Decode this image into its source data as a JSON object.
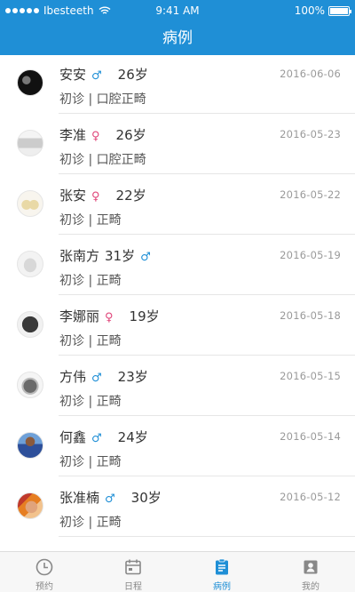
{
  "status": {
    "carrier": "Ibesteeth",
    "time": "9:41 AM",
    "battery": "100%"
  },
  "header": {
    "title": "病例"
  },
  "colors": {
    "accent": "#1f8fd6",
    "female": "#e0467a"
  },
  "records": [
    {
      "name": "安安",
      "gender": "♂",
      "gender_type": "male",
      "age": "26岁",
      "date": "2016-06-06",
      "visit": "初诊",
      "sep": "|",
      "category": "口腔正畸",
      "avatar": "avatar-dark-portrait"
    },
    {
      "name": "李准",
      "gender": "♀",
      "gender_type": "female",
      "age": "26岁",
      "date": "2016-05-23",
      "visit": "初诊",
      "sep": "|",
      "category": "口腔正畸",
      "avatar": "avatar-person"
    },
    {
      "name": "张安",
      "gender": "♀",
      "gender_type": "female",
      "age": "22岁",
      "date": "2016-05-22",
      "visit": "初诊",
      "sep": "|",
      "category": "正畸",
      "avatar": "avatar-cups"
    },
    {
      "name": "张南方",
      "gender": "♂",
      "gender_type": "male",
      "age": "31岁",
      "date": "2016-05-19",
      "visit": "初诊",
      "sep": "|",
      "category": "正畸",
      "avatar": "avatar-object"
    },
    {
      "name": "李娜丽",
      "gender": "♀",
      "gender_type": "female",
      "age": "19岁",
      "date": "2016-05-18",
      "visit": "初诊",
      "sep": "|",
      "category": "正畸",
      "avatar": "avatar-rock"
    },
    {
      "name": "方伟",
      "gender": "♂",
      "gender_type": "male",
      "age": "23岁",
      "date": "2016-05-15",
      "visit": "初诊",
      "sep": "|",
      "category": "正畸",
      "avatar": "avatar-rock-grey"
    },
    {
      "name": "何鑫",
      "gender": "♂",
      "gender_type": "male",
      "age": "24岁",
      "date": "2016-05-14",
      "visit": "初诊",
      "sep": "|",
      "category": "正畸",
      "avatar": "avatar-player"
    },
    {
      "name": "张准楠",
      "gender": "♂",
      "gender_type": "male",
      "age": "30岁",
      "date": "2016-05-12",
      "visit": "初诊",
      "sep": "|",
      "category": "正畸",
      "avatar": "avatar-face"
    }
  ],
  "tabs": [
    {
      "label": "预约",
      "icon": "clock-icon"
    },
    {
      "label": "日程",
      "icon": "calendar-icon"
    },
    {
      "label": "病例",
      "icon": "clipboard-icon",
      "active": true
    },
    {
      "label": "我的",
      "icon": "profile-icon"
    }
  ]
}
